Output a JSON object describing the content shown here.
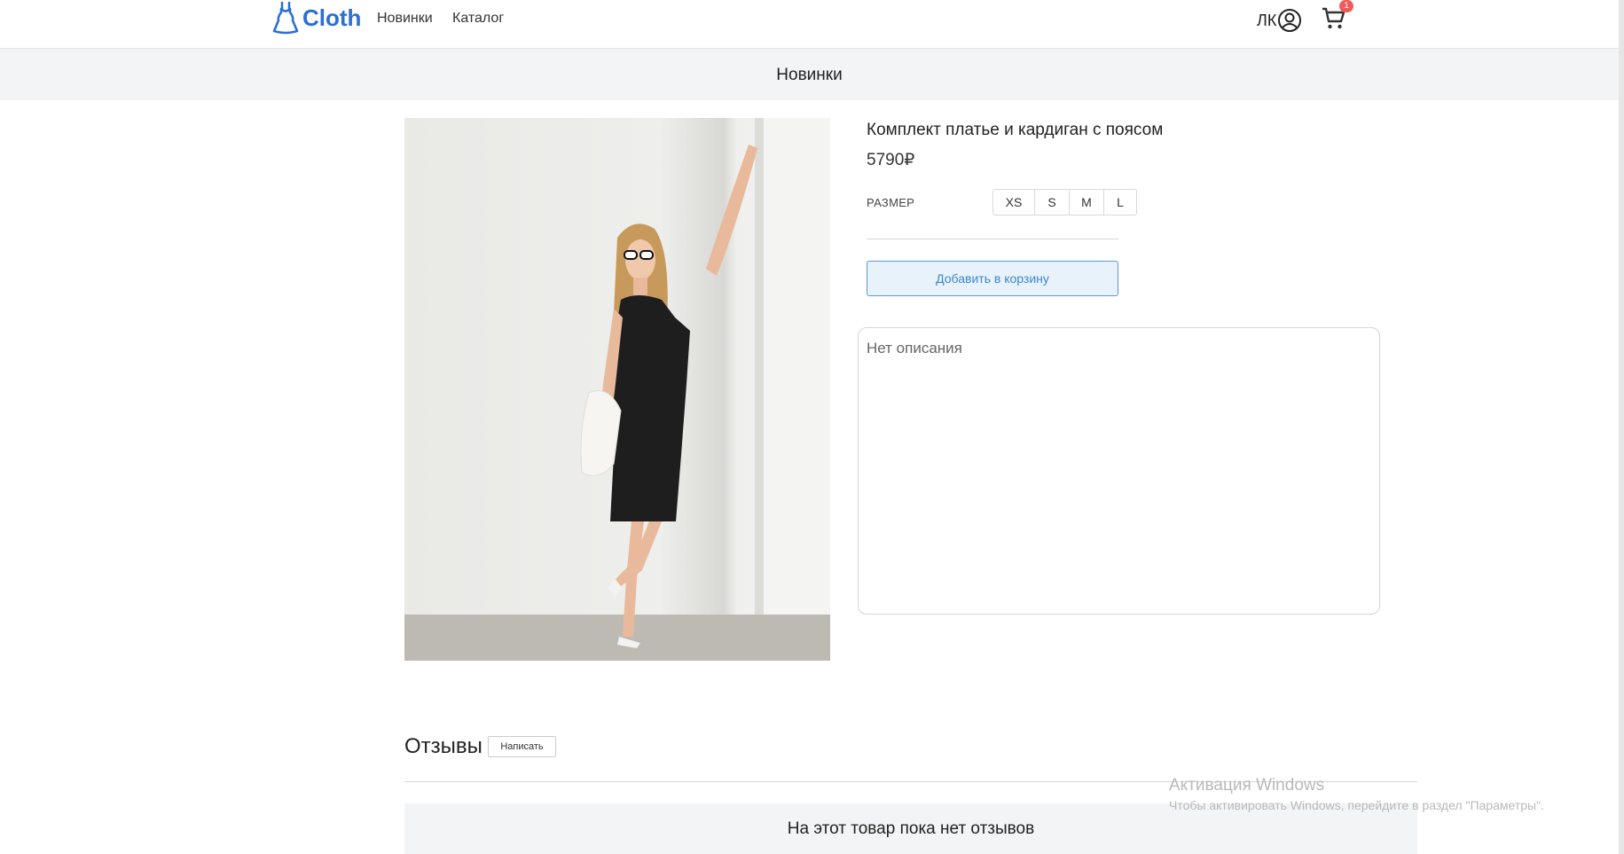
{
  "header": {
    "brand": "Cloth",
    "nav": [
      "Новинки",
      "Каталог"
    ],
    "account_label": "ЛК",
    "cart_count": "1",
    "brand_color": "#2a6fd6"
  },
  "banner": {
    "title": "Новинки"
  },
  "product": {
    "title": "Комплект платье и кардиган с поясом",
    "price": "5790₽",
    "size_label": "РАЗМЕР",
    "sizes": [
      "XS",
      "S",
      "M",
      "L"
    ],
    "add_to_cart": "Добавить в корзину",
    "description": "Нет описания"
  },
  "reviews": {
    "title": "Отзывы",
    "write_button": "Написать",
    "empty_text": "На этот товар пока нет отзывов"
  },
  "watermark": {
    "title": "Активация Windows",
    "subtitle": "Чтобы активировать Windows, перейдите в раздел \"Параметры\"."
  }
}
